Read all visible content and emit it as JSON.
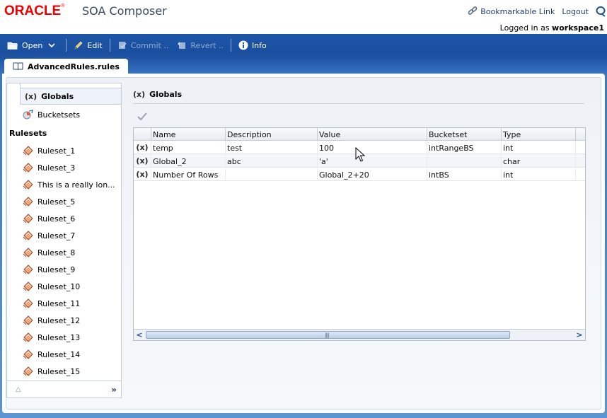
{
  "header": {
    "logo_text": "ORACLE",
    "logo_reg": "®",
    "product": "SOA Composer",
    "bookmarkable_link": "Bookmarkable Link",
    "logout": "Logout",
    "logged_in_prefix": "Logged in as",
    "username": "workspace1"
  },
  "toolbar": {
    "open": "Open",
    "edit": "Edit",
    "commit": "Commit ..",
    "revert": "Revert ..",
    "info": "Info"
  },
  "tab": {
    "label": "AdvancedRules.rules"
  },
  "nav": {
    "globals_icon_text": "(x)",
    "globals": "Globals",
    "bucketsets": "Bucketsets",
    "rulesets_heading": "Rulesets",
    "rulesets": [
      "Ruleset_1",
      "Ruleset_3",
      "This is a really lon...",
      "Ruleset_5",
      "Ruleset_6",
      "Ruleset_7",
      "Ruleset_8",
      "Ruleset_9",
      "Ruleset_10",
      "Ruleset_11",
      "Ruleset_12",
      "Ruleset_13",
      "Ruleset_14",
      "Ruleset_15"
    ],
    "collapse_glyph": "△",
    "expand_glyph": "»"
  },
  "content": {
    "title_icon_text": "(x)",
    "title": "Globals"
  },
  "table": {
    "columns": [
      "Name",
      "Description",
      "Value",
      "Bucketset",
      "Type"
    ],
    "row_icon_text": "(x)",
    "rows": [
      {
        "name": "temp",
        "description": "test",
        "value": "100",
        "bucketset": "intRangeBS",
        "type": "int"
      },
      {
        "name": "Global_2",
        "description": "abc",
        "value": "'a'",
        "bucketset": "",
        "type": "char"
      },
      {
        "name": "Number Of Rows",
        "description": "",
        "value": "Global_2+20",
        "bucketset": "intBS",
        "type": "int"
      }
    ],
    "scroll_left_glyph": "<",
    "scroll_right_glyph": ">",
    "scroll_grip": "||||"
  },
  "colors": {
    "oracle_red": "#e00000",
    "toolbar_blue": "#1c55a7",
    "link_blue": "#1f3f6e"
  },
  "icons": {
    "open": "folder-icon",
    "edit": "pencil-icon",
    "commit": "commit-icon",
    "revert": "revert-icon",
    "info": "info-icon",
    "tab": "book-icon",
    "bucketsets": "bucketset-icon",
    "ruleset": "ruleset-icon",
    "validate": "checkmark-icon"
  }
}
